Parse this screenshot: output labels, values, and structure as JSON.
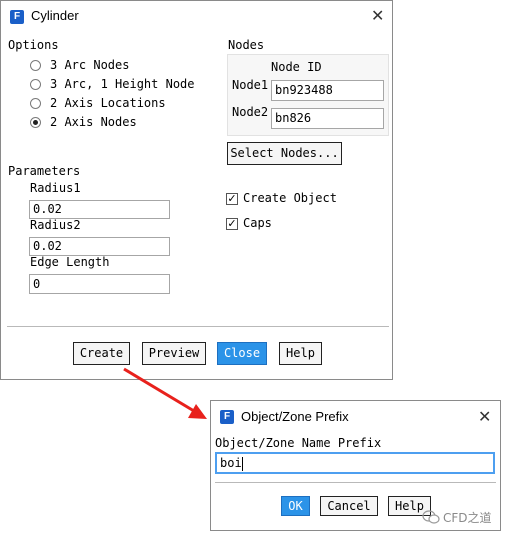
{
  "cylinder": {
    "title": "Cylinder",
    "options_label": "Options",
    "options": [
      {
        "label": "3 Arc Nodes",
        "selected": false
      },
      {
        "label": "3 Arc, 1 Height Node",
        "selected": false
      },
      {
        "label": "2 Axis Locations",
        "selected": false
      },
      {
        "label": "2 Axis Nodes",
        "selected": true
      }
    ],
    "nodes_label": "Nodes",
    "node_id_header": "Node ID",
    "node1_label": "Node1",
    "node1_value": "bn923488",
    "node2_label": "Node2",
    "node2_value": "bn826",
    "select_nodes_label": "Select Nodes...",
    "parameters_label": "Parameters",
    "radius1_label": "Radius1",
    "radius1_value": "0.02",
    "radius2_label": "Radius2",
    "radius2_value": "0.02",
    "edge_length_label": "Edge Length",
    "edge_length_value": "0",
    "create_object_label": "Create Object",
    "create_object_checked": true,
    "caps_label": "Caps",
    "caps_checked": true,
    "buttons": {
      "create": "Create",
      "preview": "Preview",
      "close": "Close",
      "help": "Help"
    }
  },
  "prefix_dialog": {
    "title": "Object/Zone Prefix",
    "field_label": "Object/Zone Name Prefix",
    "field_value": "boi",
    "buttons": {
      "ok": "OK",
      "cancel": "Cancel",
      "help": "Help"
    }
  },
  "watermark": "CFD之道",
  "colors": {
    "accent": "#2b93e8",
    "arrow": "#e8211c",
    "icon": "#1a5fc8"
  },
  "icons": {
    "app": "app-f-icon",
    "close": "close-icon",
    "arrow": "red-arrow-icon",
    "watermark": "wechat-icon"
  }
}
